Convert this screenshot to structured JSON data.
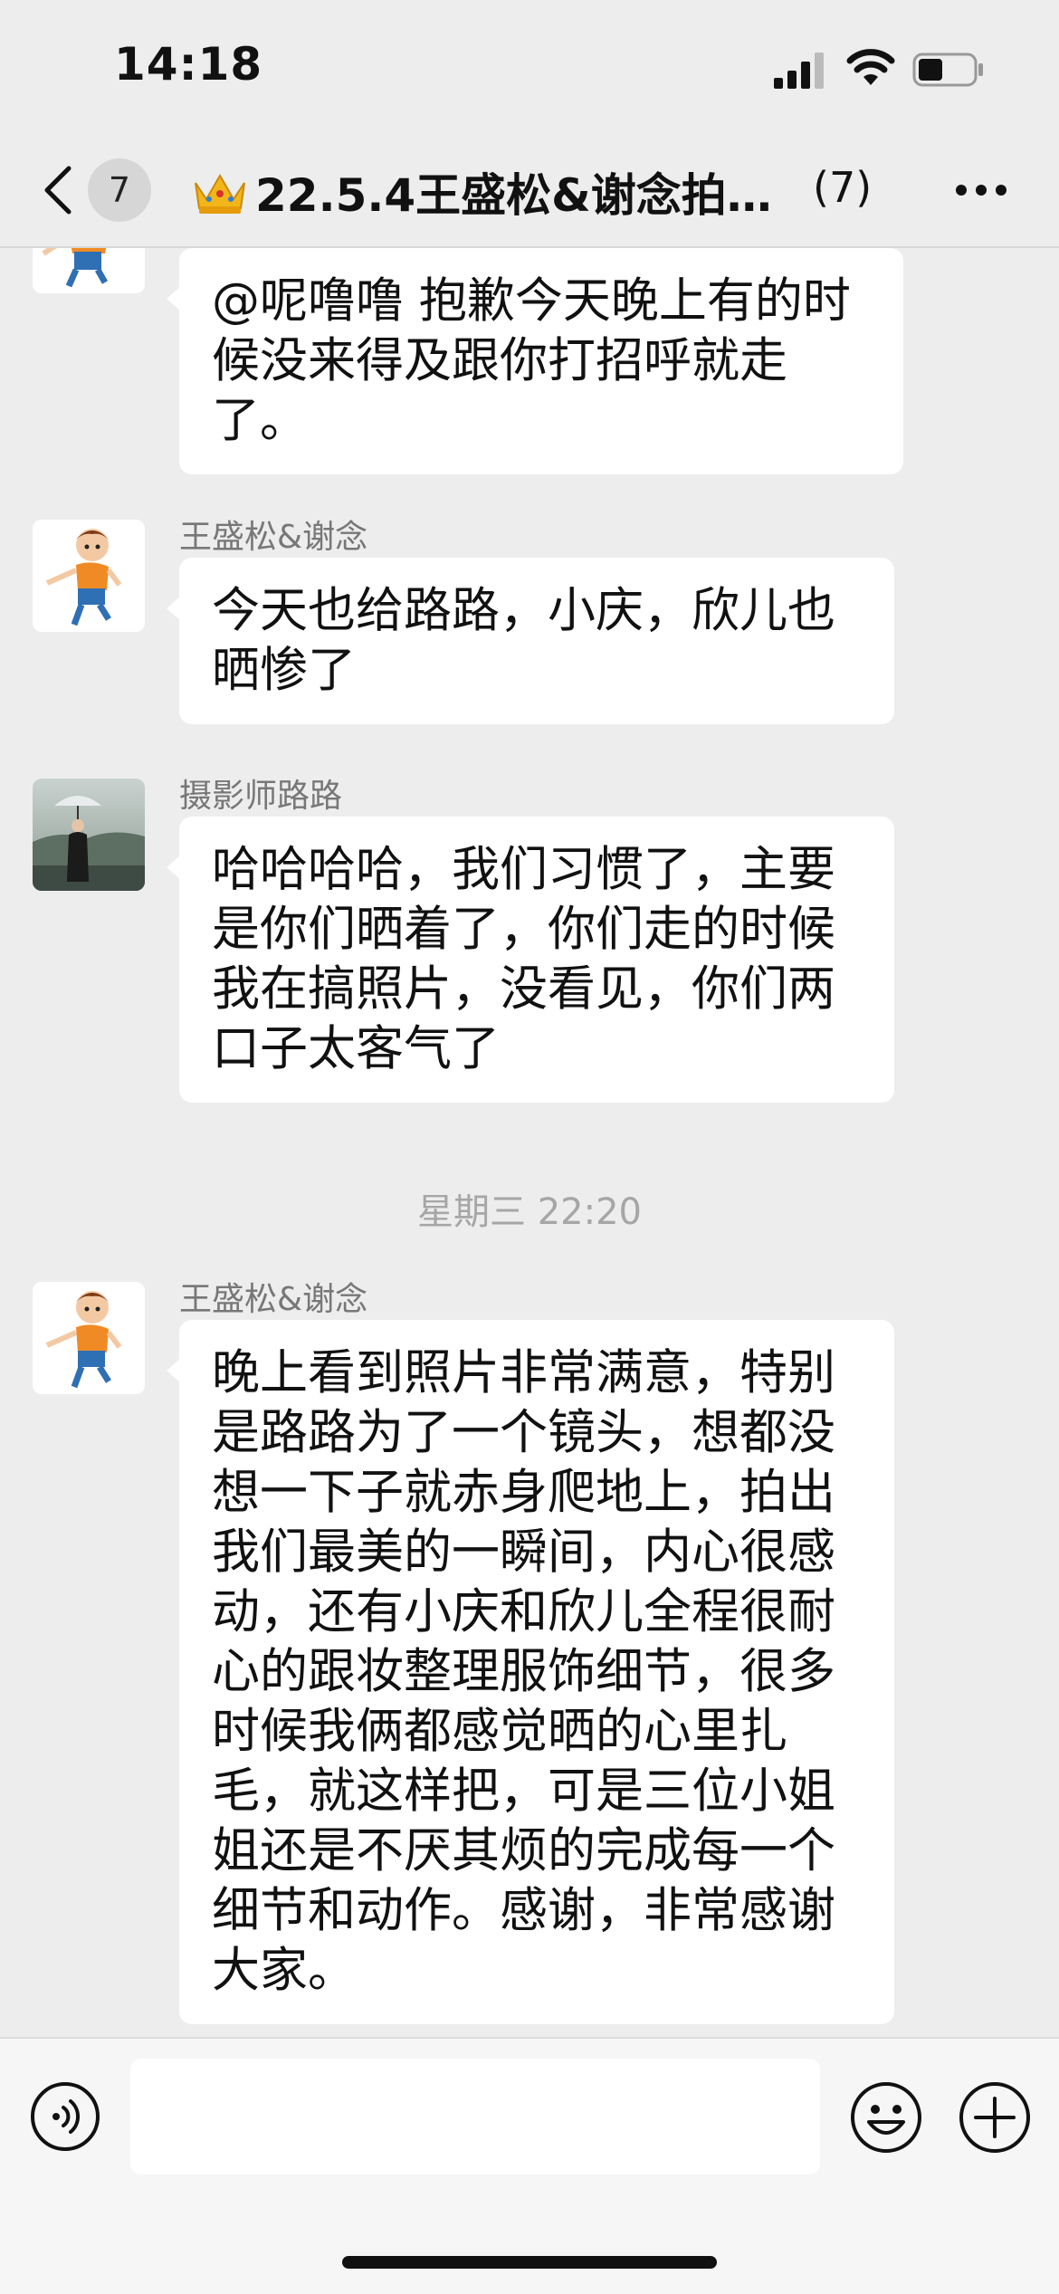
{
  "status_bar": {
    "time": "14:18",
    "battery_level": 0.45
  },
  "nav": {
    "unread_count": "7",
    "crown_icon": "crown-emoji",
    "title": "22.5.4王盛松&谢念拍…",
    "member_count": "(7)"
  },
  "messages": [
    {
      "sender": "",
      "text": "@呢噜噜 抱歉今天晚上有的时候没来得及跟你打招呼就走了。",
      "avatar": "cartoon-boy-avatar"
    },
    {
      "sender": "王盛松&谢念",
      "text": "今天也给路路，小庆，欣儿也晒惨了",
      "avatar": "cartoon-boy-avatar"
    },
    {
      "sender": "摄影师路路",
      "text": "哈哈哈哈，我们习惯了，主要是你们晒着了，你们走的时候我在搞照片，没看见，你们两口子太客气了",
      "avatar": "photo-avatar-umbrella"
    },
    {
      "sender": "王盛松&谢念",
      "text": "晚上看到照片非常满意，特别是路路为了一个镜头，想都没想一下子就赤身爬地上，拍出我们最美的一瞬间，内心很感动，还有小庆和欣儿全程很耐心的跟妆整理服饰细节，很多时候我俩都感觉晒的心里扎毛，就这样把，可是三位小姐姐还是不厌其烦的完成每一个细节和动作。感谢，非常感谢大家。",
      "avatar": "cartoon-boy-avatar"
    }
  ],
  "timestamp_divider": "星期三 22:20",
  "input_bar": {
    "placeholder": ""
  },
  "colors": {
    "background": "#ededed",
    "bubble": "#ffffff",
    "sender": "#777777",
    "timestamp": "#a6a6a6"
  }
}
